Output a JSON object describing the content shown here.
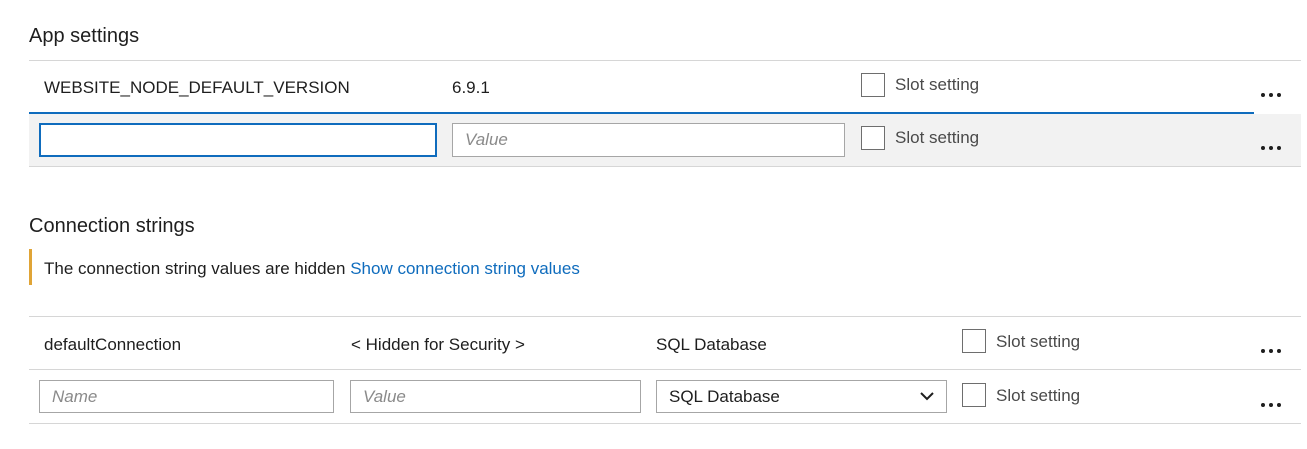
{
  "app_settings": {
    "title": "App settings",
    "rows": [
      {
        "name": "WEBSITE_NODE_DEFAULT_VERSION",
        "value": "6.9.1",
        "slot_label": "Slot setting"
      }
    ],
    "new_row": {
      "name_value": "",
      "value_placeholder": "Value",
      "slot_label": "Slot setting"
    }
  },
  "connection_strings": {
    "title": "Connection strings",
    "notice": {
      "text": "The connection string values are hidden",
      "link": "Show connection string values"
    },
    "rows": [
      {
        "name": "defaultConnection",
        "value": "< Hidden for Security >",
        "type": "SQL Database",
        "slot_label": "Slot setting"
      }
    ],
    "new_row": {
      "name_placeholder": "Name",
      "value_placeholder": "Value",
      "type_selected": "SQL Database",
      "slot_label": "Slot setting"
    }
  },
  "colors": {
    "accent": "#0f6cbd",
    "notice_bar": "#e0a436",
    "row_highlight": "#f2f2f2"
  },
  "icons": [
    "checkbox-icon",
    "more-options-icon",
    "chevron-down-icon"
  ]
}
